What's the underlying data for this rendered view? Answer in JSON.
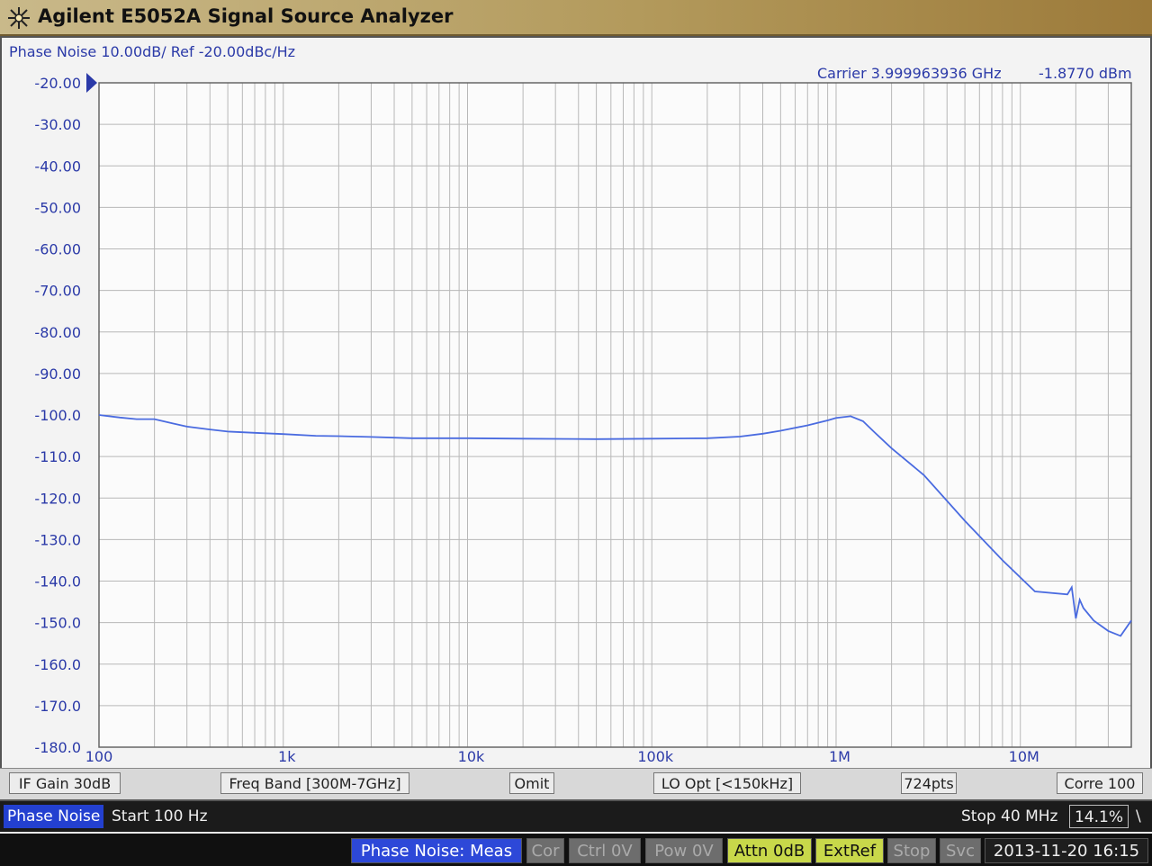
{
  "app": {
    "title": "Agilent E5052A Signal Source Analyzer"
  },
  "trace": {
    "header": "Phase Noise 10.00dB/ Ref -20.00dBc/Hz",
    "carrier": "Carrier 3.999963936 GHz",
    "carrier_power": "-1.8770 dBm",
    "color": "#4a6be0"
  },
  "chart_data": {
    "type": "line",
    "title": "",
    "xlabel": "",
    "ylabel": "",
    "xscale": "log",
    "xlim": [
      100,
      40000000
    ],
    "ylim": [
      -180,
      -20
    ],
    "grid": true,
    "yticks": [
      "-20.00",
      "-30.00",
      "-40.00",
      "-50.00",
      "-60.00",
      "-70.00",
      "-80.00",
      "-90.00",
      "-100.0",
      "-110.0",
      "-120.0",
      "-130.0",
      "-140.0",
      "-150.0",
      "-160.0",
      "-170.0",
      "-180.0"
    ],
    "xticks": [
      {
        "v": 100,
        "label": "100"
      },
      {
        "v": 1000,
        "label": "1k"
      },
      {
        "v": 10000,
        "label": "10k"
      },
      {
        "v": 100000,
        "label": "100k"
      },
      {
        "v": 1000000,
        "label": "1M"
      },
      {
        "v": 10000000,
        "label": "10M"
      }
    ],
    "series": [
      {
        "x": [
          100,
          130,
          160,
          200,
          250,
          300,
          400,
          500,
          700,
          1000,
          1500,
          2000,
          3000,
          5000,
          10000,
          20000,
          50000,
          100000,
          200000,
          300000,
          400000,
          500000,
          700000,
          900000,
          1000000,
          1200000,
          1400000,
          1600000,
          2000000,
          3000000,
          5000000,
          8000000,
          12000000,
          18000000,
          19000000,
          20000000,
          21000000,
          22000000,
          25000000,
          30000000,
          35000000,
          40000000
        ],
        "y": [
          -100,
          -100.6,
          -101,
          -101,
          -102,
          -102.8,
          -103.5,
          -104,
          -104.3,
          -104.6,
          -105,
          -105.1,
          -105.3,
          -105.6,
          -105.6,
          -105.7,
          -105.8,
          -105.7,
          -105.6,
          -105.2,
          -104.5,
          -103.8,
          -102.5,
          -101.3,
          -100.7,
          -100.3,
          -101.5,
          -104,
          -108,
          -114.5,
          -125.5,
          -135,
          -142.5,
          -143.2,
          -141.5,
          -149,
          -144.5,
          -146.5,
          -149.5,
          -152,
          -153.2,
          -149.5
        ]
      }
    ]
  },
  "status": {
    "if_gain": "IF Gain 30dB",
    "freq_band": "Freq Band [300M-7GHz]",
    "omit": "Omit",
    "lo_opt": "LO Opt [<150kHz]",
    "points": "724pts",
    "corr": "Corre 100"
  },
  "sweep": {
    "mode": "Phase Noise",
    "start": "Start 100 Hz",
    "stop": "Stop 40 MHz",
    "progress": "14.1%",
    "extra": "\\"
  },
  "messages": {
    "meas": "Phase Noise: Meas",
    "cor": "Cor",
    "ctrl": "Ctrl  0V",
    "pow": "Pow  0V",
    "attn": "Attn 0dB",
    "extref": "ExtRef",
    "stop": "Stop",
    "svc": "Svc",
    "datetime": "2013-11-20 16:15"
  }
}
